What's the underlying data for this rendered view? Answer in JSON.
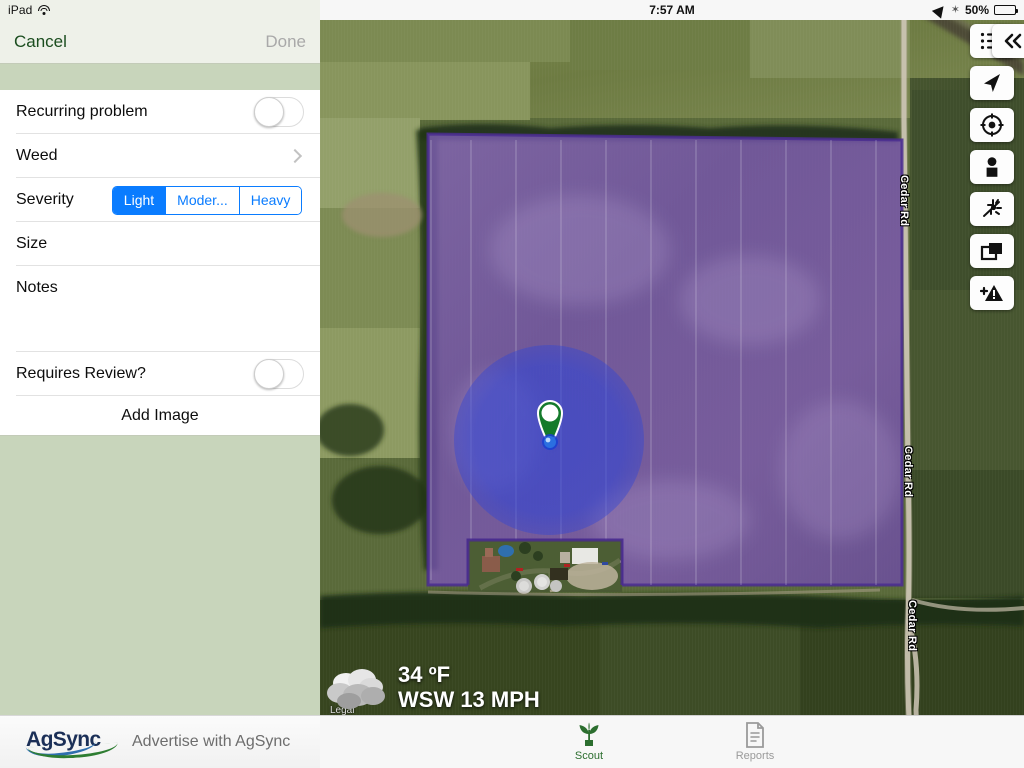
{
  "left_panel": {
    "status": {
      "device": "iPad",
      "wifi_icon": "wifi-icon"
    },
    "nav": {
      "cancel": "Cancel",
      "done": "Done"
    },
    "form": {
      "recurring": {
        "label": "Recurring problem",
        "value": "off"
      },
      "category": {
        "label": "Weed",
        "disclosure_icon": "chevron-right-icon"
      },
      "severity": {
        "label": "Severity",
        "options": [
          "Light",
          "Moder...",
          "Heavy"
        ],
        "selected": "Light"
      },
      "size": {
        "label": "Size",
        "value": ""
      },
      "notes": {
        "label": "Notes",
        "value": ""
      },
      "requires_review": {
        "label": "Requires Review?",
        "value": "off"
      },
      "add_image": {
        "label": "Add Image"
      }
    },
    "ad": {
      "logo_text": "AgSync",
      "text": "Advertise with AgSync"
    }
  },
  "map": {
    "status": {
      "time": "7:57 AM",
      "location_icon": "location-arrow-icon",
      "bluetooth_icon": "bluetooth-icon",
      "battery_pct": "50%"
    },
    "toolbar": [
      {
        "name": "list-button",
        "icon": "list-icon"
      },
      {
        "name": "locate-button",
        "icon": "navigation-arrow-icon"
      },
      {
        "name": "center-button",
        "icon": "crosshair-icon"
      },
      {
        "name": "person-button",
        "icon": "person-icon"
      },
      {
        "name": "scout-button",
        "icon": "pest-icon"
      },
      {
        "name": "layers-button",
        "icon": "layers-icon"
      },
      {
        "name": "add-alert-button",
        "icon": "add-alert-icon"
      }
    ],
    "collapse": {
      "icon": "double-chevron-left-icon"
    },
    "weather": {
      "icon": "cloudy-icon",
      "temperature": "34 ºF",
      "wind": "WSW 13 MPH"
    },
    "legal": "Legal",
    "road_labels": [
      "Cedar Rd",
      "Cedar Rd",
      "Cedar Rd"
    ],
    "pin": {
      "icon": "map-pin-icon"
    },
    "user_location": {
      "icon": "user-location-dot-icon"
    },
    "field_overlay_color": "#7b52c4",
    "accuracy_circle_color": "#3b4fd8"
  },
  "tabs": [
    {
      "label": "Scout",
      "icon": "plant-icon",
      "active": true
    },
    {
      "label": "Reports",
      "icon": "document-icon",
      "active": false
    }
  ],
  "colors": {
    "accent_blue": "#0a7cff",
    "panel_green": "#c8d5bb",
    "cancel_green": "#1b4d1f",
    "tab_active_green": "#2c6e2f"
  }
}
